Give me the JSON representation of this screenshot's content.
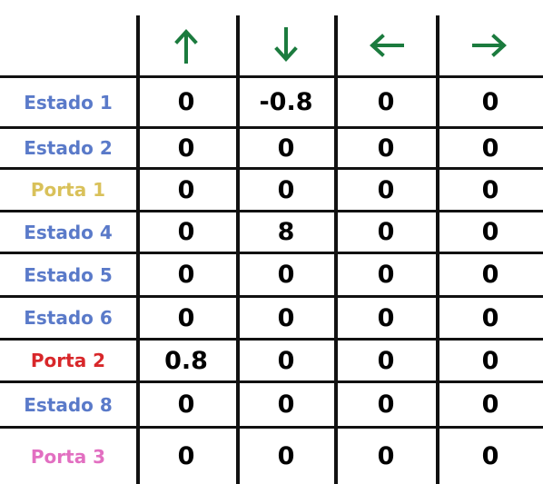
{
  "colors": {
    "arrow": "#1b7b3e",
    "grid_line": "#111111",
    "value_text": "#000000"
  },
  "columns": [
    {
      "direction": "up",
      "icon": "arrow-up-icon",
      "symbol": "↑"
    },
    {
      "direction": "down",
      "icon": "arrow-down-icon",
      "symbol": "↓"
    },
    {
      "direction": "left",
      "icon": "arrow-left-icon",
      "symbol": "←"
    },
    {
      "direction": "right",
      "icon": "arrow-right-icon",
      "symbol": "→"
    }
  ],
  "rows": [
    {
      "label": "Estado 1",
      "color": "#5a7ac9",
      "values": [
        "0",
        "-0.8",
        "0",
        "0"
      ]
    },
    {
      "label": "Estado 2",
      "color": "#5a7ac9",
      "values": [
        "0",
        "0",
        "0",
        "0"
      ]
    },
    {
      "label": "Porta 1",
      "color": "#d9c15a",
      "values": [
        "0",
        "0",
        "0",
        "0"
      ]
    },
    {
      "label": "Estado 4",
      "color": "#5a7ac9",
      "values": [
        "0",
        "8",
        "0",
        "0"
      ]
    },
    {
      "label": "Estado 5",
      "color": "#5a7ac9",
      "values": [
        "0",
        "0",
        "0",
        "0"
      ]
    },
    {
      "label": "Estado 6",
      "color": "#5a7ac9",
      "values": [
        "0",
        "0",
        "0",
        "0"
      ]
    },
    {
      "label": "Porta 2",
      "color": "#d8272a",
      "values": [
        "0.8",
        "0",
        "0",
        "0"
      ]
    },
    {
      "label": "Estado 8",
      "color": "#5a7ac9",
      "values": [
        "0",
        "0",
        "0",
        "0"
      ]
    },
    {
      "label": "Porta 3",
      "color": "#e26fc1",
      "values": [
        "0",
        "0",
        "0",
        "0"
      ]
    }
  ]
}
